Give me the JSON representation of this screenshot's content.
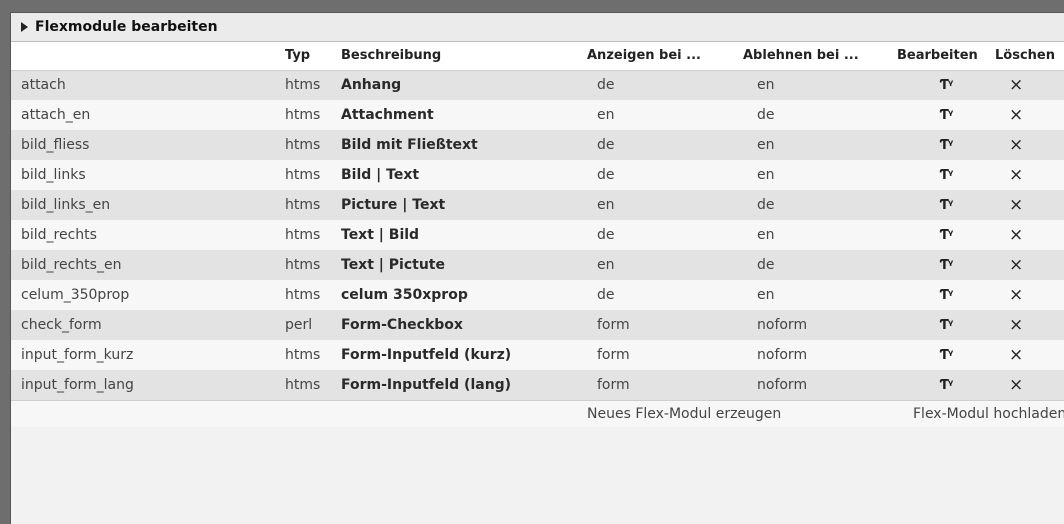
{
  "panel": {
    "title": "Flexmodule bearbeiten"
  },
  "columns": {
    "name": "",
    "type": "Typ",
    "description": "Beschreibung",
    "show": "Anzeigen bei ...",
    "reject": "Ablehnen bei ...",
    "edit": "Bearbeiten",
    "delete": "Löschen"
  },
  "icons": {
    "edit": "edit-icon",
    "delete": "delete-icon",
    "expand": "triangle-right-icon"
  },
  "rows": [
    {
      "name": "attach",
      "type": "htms",
      "description": "Anhang",
      "show": "de",
      "reject": "en"
    },
    {
      "name": "attach_en",
      "type": "htms",
      "description": "Attachment",
      "show": "en",
      "reject": "de"
    },
    {
      "name": "bild_fliess",
      "type": "htms",
      "description": "Bild mit Fließtext",
      "show": "de",
      "reject": "en"
    },
    {
      "name": "bild_links",
      "type": "htms",
      "description": "Bild | Text",
      "show": "de",
      "reject": "en"
    },
    {
      "name": "bild_links_en",
      "type": "htms",
      "description": "Picture | Text",
      "show": "en",
      "reject": "de"
    },
    {
      "name": "bild_rechts",
      "type": "htms",
      "description": "Text | Bild",
      "show": "de",
      "reject": "en"
    },
    {
      "name": "bild_rechts_en",
      "type": "htms",
      "description": "Text | Pictute",
      "show": "en",
      "reject": "de"
    },
    {
      "name": "celum_350prop",
      "type": "htms",
      "description": "celum 350xprop",
      "show": "de",
      "reject": "en"
    },
    {
      "name": "check_form",
      "type": "perl",
      "description": "Form-Checkbox",
      "show": "form",
      "reject": "noform"
    },
    {
      "name": "input_form_kurz",
      "type": "htms",
      "description": "Form-Inputfeld (kurz)",
      "show": "form",
      "reject": "noform"
    },
    {
      "name": "input_form_lang",
      "type": "htms",
      "description": "Form-Inputfeld (lang)",
      "show": "form",
      "reject": "noform"
    }
  ],
  "footer": {
    "new_module": "Neues Flex-Modul erzeugen",
    "upload_module": "Flex-Modul hochladen"
  }
}
